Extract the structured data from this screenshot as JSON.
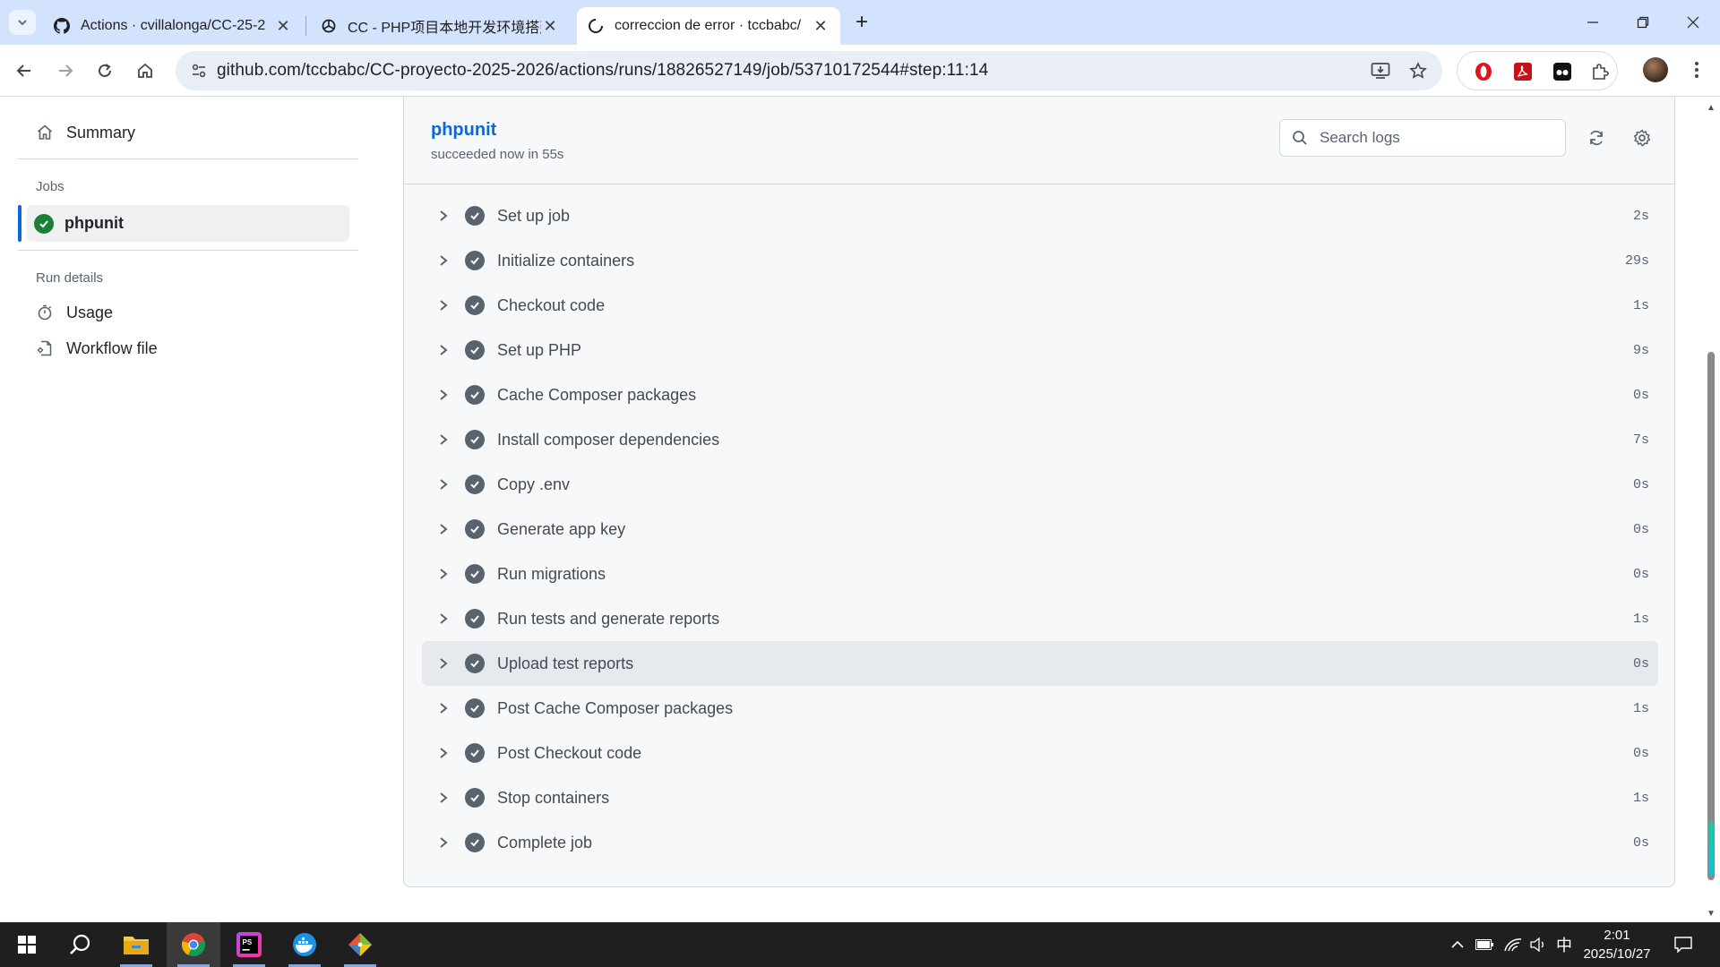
{
  "browser": {
    "tabs": [
      {
        "title": "Actions · cvillalonga/CC-25-2",
        "favicon": "github-icon",
        "active": false
      },
      {
        "title": "CC - PHP项目本地开发环境搭建",
        "favicon": "openai-icon",
        "active": false
      },
      {
        "title": "correccion de error · tccbabc/",
        "favicon": "github-icon",
        "active": true
      }
    ],
    "url": "github.com/tccbabc/CC-proyecto-2025-2026/actions/runs/18826527149/job/53710172544#step:11:14"
  },
  "sidebar": {
    "summary_label": "Summary",
    "jobs_heading": "Jobs",
    "job_label": "phpunit",
    "run_details_heading": "Run details",
    "usage_label": "Usage",
    "workflow_file_label": "Workflow file"
  },
  "job": {
    "title": "phpunit",
    "status": "succeeded now in 55s",
    "search_placeholder": "Search logs"
  },
  "steps": [
    {
      "name": "Set up job",
      "duration": "2s"
    },
    {
      "name": "Initialize containers",
      "duration": "29s"
    },
    {
      "name": "Checkout code",
      "duration": "1s"
    },
    {
      "name": "Set up PHP",
      "duration": "9s"
    },
    {
      "name": "Cache Composer packages",
      "duration": "0s"
    },
    {
      "name": "Install composer dependencies",
      "duration": "7s"
    },
    {
      "name": "Copy .env",
      "duration": "0s"
    },
    {
      "name": "Generate app key",
      "duration": "0s"
    },
    {
      "name": "Run migrations",
      "duration": "0s"
    },
    {
      "name": "Run tests and generate reports",
      "duration": "1s"
    },
    {
      "name": "Upload test reports",
      "duration": "0s"
    },
    {
      "name": "Post Cache Composer packages",
      "duration": "1s"
    },
    {
      "name": "Post Checkout code",
      "duration": "0s"
    },
    {
      "name": "Stop containers",
      "duration": "1s"
    },
    {
      "name": "Complete job",
      "duration": "0s"
    }
  ],
  "highlighted_step": 10,
  "taskbar": {
    "ime": "中",
    "time": "2:01",
    "date": "2025/10/27"
  },
  "colors": {
    "link": "#0969da",
    "success": "#1a7f37",
    "step_check": "#59636e"
  }
}
